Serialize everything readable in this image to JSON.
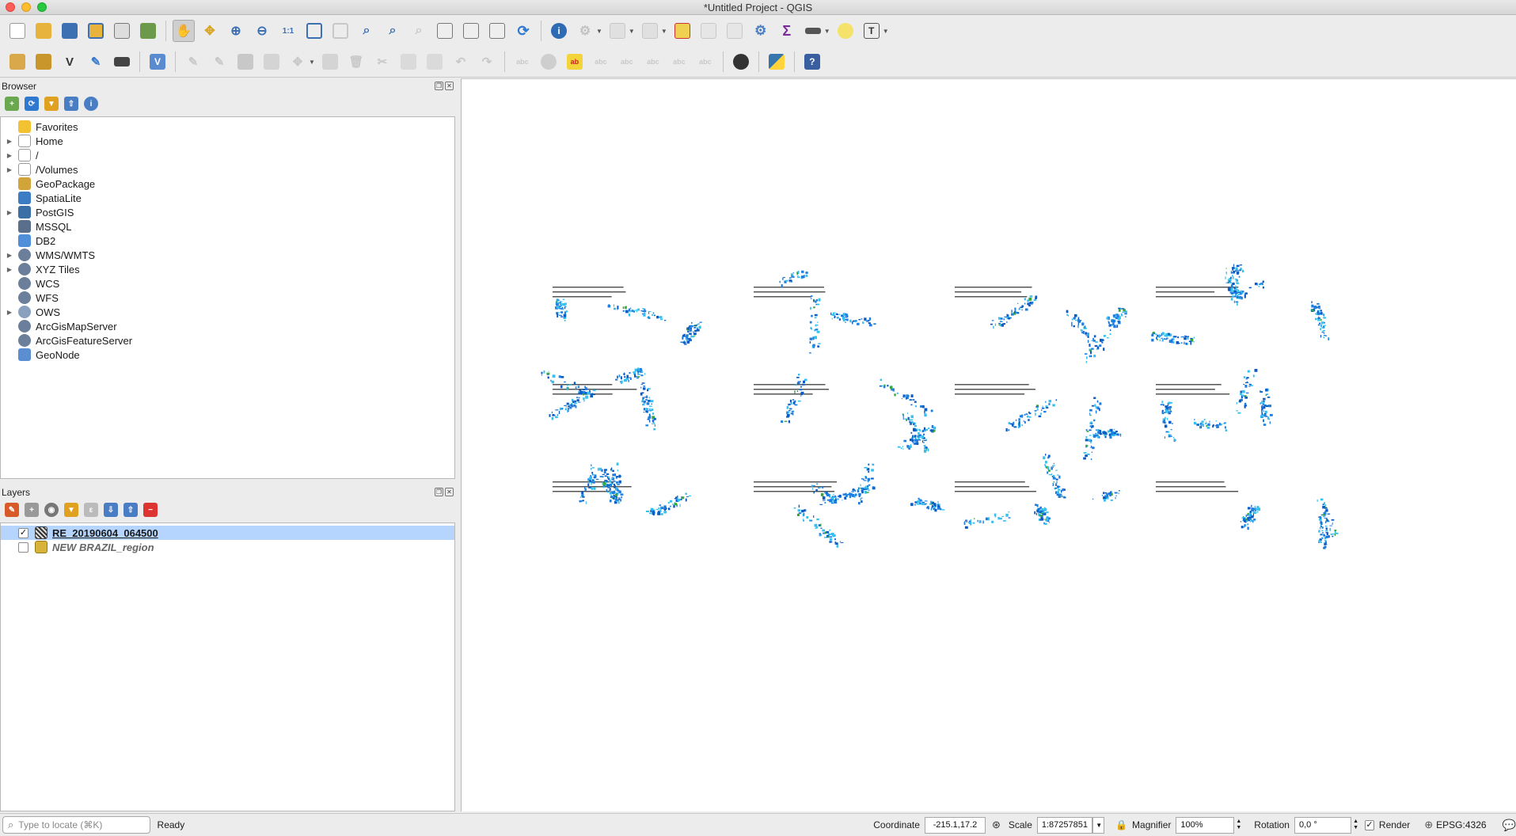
{
  "window": {
    "title": "*Untitled Project - QGIS"
  },
  "toolbar1": {
    "icons": [
      "new-project",
      "open-project",
      "save-project",
      "save-as",
      "print-layout",
      "style-manager",
      "pan",
      "pan-to-selection",
      "zoom-in",
      "zoom-out",
      "zoom-native",
      "zoom-full",
      "zoom-to-selection",
      "zoom-to-layer",
      "zoom-last",
      "zoom-next",
      "new-map-view",
      "new-bookmark",
      "show-bookmarks",
      "refresh",
      "identify",
      "action",
      "select-features",
      "deselect",
      "open-attribute-table",
      "field-calculator",
      "toolbox",
      "statistics",
      "measure",
      "annotation",
      "text-annotation"
    ]
  },
  "toolbar2": {
    "icons": [
      "data-source-manager",
      "new-geopackage",
      "vector-tool",
      "digitize-pen",
      "gps-tool",
      "check-geometry",
      "edit-pencil",
      "toggle-edit",
      "save-edits",
      "add-feature",
      "vertex-tool",
      "modify-attributes",
      "delete-selected",
      "cut",
      "copy",
      "paste",
      "undo",
      "redo",
      "label-tool",
      "label-pin",
      "label-highlight",
      "label-show",
      "label-move",
      "label-rotate",
      "label-change",
      "quickmapservices",
      "python-console",
      "help"
    ]
  },
  "browser": {
    "title": "Browser",
    "items": [
      {
        "label": "Favorites",
        "icon": "star-icon",
        "expandable": false,
        "color": "#f2c232"
      },
      {
        "label": "Home",
        "icon": "home-folder-icon",
        "expandable": true,
        "color": "#9a9a9a"
      },
      {
        "label": "/",
        "icon": "folder-icon",
        "expandable": true,
        "color": "#9a9a9a"
      },
      {
        "label": "/Volumes",
        "icon": "folder-icon",
        "expandable": true,
        "color": "#9a9a9a"
      },
      {
        "label": "GeoPackage",
        "icon": "geopackage-icon",
        "expandable": false,
        "color": "#d2a43a"
      },
      {
        "label": "SpatiaLite",
        "icon": "spatialite-icon",
        "expandable": false,
        "color": "#3b7cc4"
      },
      {
        "label": "PostGIS",
        "icon": "postgis-icon",
        "expandable": true,
        "color": "#3b6fa6"
      },
      {
        "label": "MSSQL",
        "icon": "mssql-icon",
        "expandable": false,
        "color": "#5a6f8a"
      },
      {
        "label": "DB2",
        "icon": "db2-icon",
        "expandable": false,
        "color": "#4f8ed8"
      },
      {
        "label": "WMS/WMTS",
        "icon": "globe-icon",
        "expandable": true,
        "color": "#6b7f9a"
      },
      {
        "label": "XYZ Tiles",
        "icon": "globe-icon",
        "expandable": true,
        "color": "#6b7f9a"
      },
      {
        "label": "WCS",
        "icon": "globe-icon",
        "expandable": false,
        "color": "#6b7f9a"
      },
      {
        "label": "WFS",
        "icon": "globe-icon",
        "expandable": false,
        "color": "#6b7f9a"
      },
      {
        "label": "OWS",
        "icon": "globe-icon",
        "expandable": true,
        "color": "#8aa0bf"
      },
      {
        "label": "ArcGisMapServer",
        "icon": "arcgis-icon",
        "expandable": false,
        "color": "#6b7f9a"
      },
      {
        "label": "ArcGisFeatureServer",
        "icon": "arcgis-icon",
        "expandable": false,
        "color": "#6b7f9a"
      },
      {
        "label": "GeoNode",
        "icon": "geonode-icon",
        "expandable": false,
        "color": "#5a8ed0"
      }
    ]
  },
  "layers": {
    "title": "Layers",
    "items": [
      {
        "label": "RE_20190604_064500",
        "checked": true,
        "selected": true,
        "icon": "raster-layer-icon"
      },
      {
        "label": "NEW BRAZIL_region",
        "checked": false,
        "selected": false,
        "icon": "polygon-layer-icon"
      }
    ]
  },
  "statusbar": {
    "locate_placeholder": "Type to locate (⌘K)",
    "message": "Ready",
    "coordinate_label": "Coordinate",
    "coordinate_value": "-215.1,17.2",
    "scale_label": "Scale",
    "scale_value": "1:87257851",
    "magnifier_label": "Magnifier",
    "magnifier_value": "100%",
    "rotation_label": "Rotation",
    "rotation_value": "0,0 °",
    "render_label": "Render",
    "render_checked": true,
    "crs_label": "EPSG:4326"
  },
  "colors": {
    "selection": "#b5d5ff",
    "radar_blue": "#1e7fe0",
    "radar_cyan": "#35c0f0",
    "radar_green": "#3aa838"
  }
}
